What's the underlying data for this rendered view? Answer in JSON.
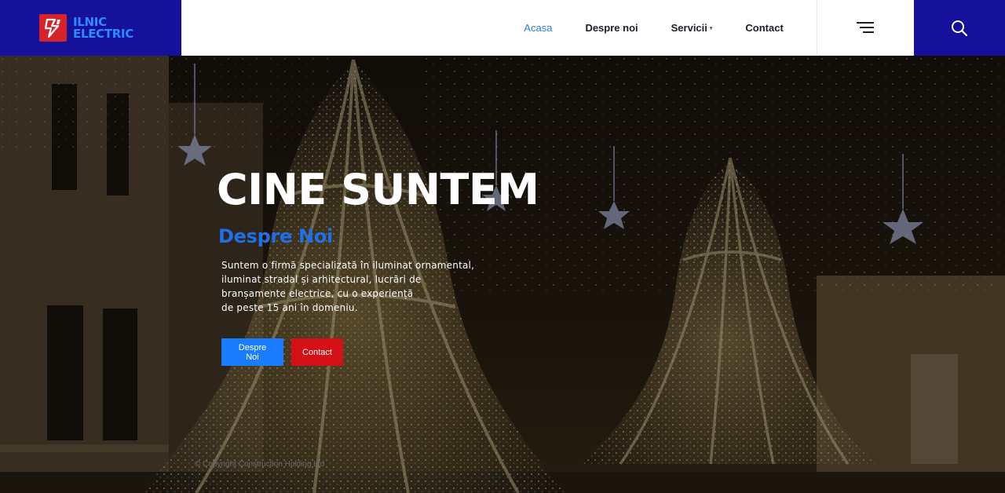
{
  "brand": {
    "line1": "ILNIC",
    "line2": "ELECTRIC",
    "color": "#15119a",
    "accent": "#d8222a"
  },
  "nav": {
    "items": [
      {
        "label": "Acasa",
        "active": true
      },
      {
        "label": "Despre noi",
        "active": false
      },
      {
        "label": "Servicii",
        "active": false,
        "caret": "▾"
      },
      {
        "label": "Contact",
        "active": false
      }
    ],
    "menu_icon": "hamburger-icon",
    "search_icon": "search-icon"
  },
  "hero": {
    "title": "CINE SUNTEM",
    "subtitle": "Despre Noi",
    "text_lines": [
      "Suntem o firmă specializată în iluminat ornamental,",
      "iluminat stradal și arhitectural, lucrări de",
      "branșamente electrice, cu o experiență",
      "de peste 15 ani în domeniu."
    ],
    "buttons": [
      {
        "label": "Despre Noi",
        "color": "#1a7dff"
      },
      {
        "label": "Contact",
        "color": "#d40f16"
      }
    ],
    "copyright": "© Copyright Construction Holding Ltd"
  }
}
